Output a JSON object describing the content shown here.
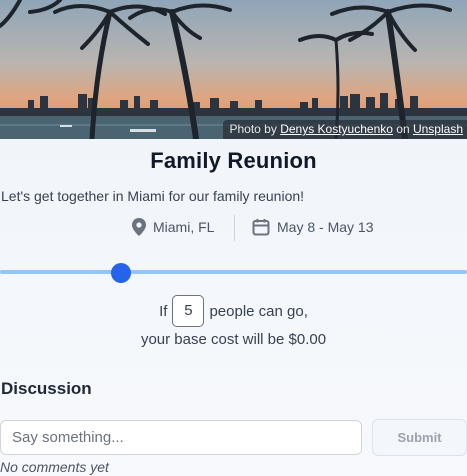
{
  "hero": {
    "credit_prefix": "Photo by",
    "credit_author": "Denys Kostyuchenko",
    "credit_on": "on",
    "credit_site": "Unsplash"
  },
  "event": {
    "title": "Family Reunion",
    "description": "Let's get together in Miami for our family reunion!",
    "location": "Miami, FL",
    "dates": "May 8 - May 13"
  },
  "slider": {
    "value": 5,
    "level_fraction": 0.26
  },
  "cost": {
    "line1_prefix": "If",
    "people_count": "5",
    "line1_suffix": "people can go,",
    "line2": "your base cost will be $0.00"
  },
  "discussion": {
    "heading": "Discussion",
    "input_placeholder": "Say something...",
    "submit_label": "Submit",
    "empty_text": "No comments yet"
  },
  "colors": {
    "accent": "#2563eb",
    "track": "#93c5fd"
  },
  "icons": [
    "location-pin-icon",
    "calendar-icon"
  ]
}
